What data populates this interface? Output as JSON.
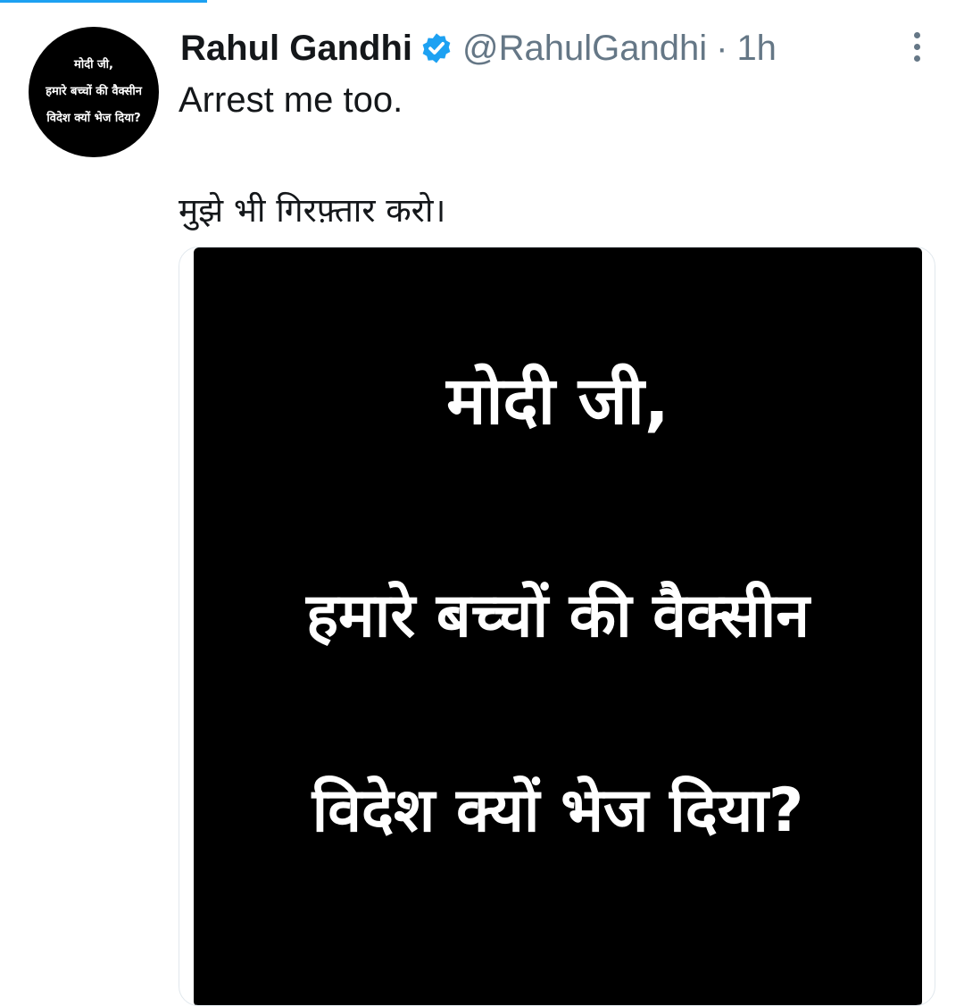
{
  "tweet": {
    "author_name": "Rahul Gandhi",
    "handle": "@RahulGandhi",
    "separator": "·",
    "time_ago": "1h",
    "text_line1": "Arrest me too.",
    "text_line2": "मुझे भी गिरफ़्तार करो।"
  },
  "avatar": {
    "lines": [
      "मोदी जी,",
      "हमारे बच्चों की वैक्सीन",
      "विदेश क्यों भेज दिया?"
    ]
  },
  "media": {
    "lines": [
      "मोदी जी,",
      "हमारे बच्चों की वैक्सीन",
      "विदेश क्यों भेज दिया?"
    ]
  },
  "icons": {
    "verified": "verified-badge-icon",
    "more": "more-options-icon"
  },
  "colors": {
    "accent": "#1da1f2",
    "text_primary": "#14171a",
    "text_secondary": "#657786",
    "image_background": "#000000"
  }
}
